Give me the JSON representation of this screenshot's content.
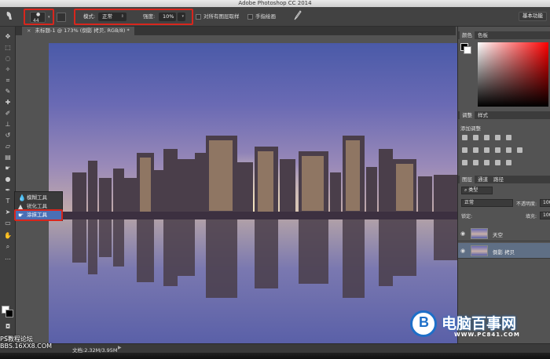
{
  "window": {
    "title": "Adobe Photoshop CC 2014"
  },
  "options": {
    "brush_size": "44",
    "mode_label": "模式:",
    "mode_value": "正常",
    "strength_label": "强度:",
    "strength_value": "10%",
    "sample_all_label": "对所有图层取样",
    "finger_paint_label": "手指绘画",
    "workspace_label": "基本功能"
  },
  "document": {
    "tab_label": "未标题-1 @ 173% (倒影 拷贝, RGB/8) *"
  },
  "tool_flyout": {
    "items": [
      {
        "label": "模糊工具"
      },
      {
        "label": "锐化工具"
      },
      {
        "label": "涂抹工具"
      }
    ]
  },
  "panels": {
    "color_tab": "颜色",
    "swatches_tab": "色板",
    "adjust_tab": "调整",
    "styles_tab": "样式",
    "add_adjust": "添加调整",
    "layers_tab": "图层",
    "channels_tab": "通道",
    "paths_tab": "路径",
    "kind_label": "类型",
    "blend_mode": "正常",
    "opacity_label": "不透明度:",
    "opacity_value": "100",
    "lock_label": "锁定:",
    "fill_label": "填充:",
    "fill_value": "100",
    "layers": [
      {
        "name": "天空"
      },
      {
        "name": "倒影 拷贝"
      }
    ]
  },
  "status": {
    "doc_info": "文档:2.32M/3.95M"
  },
  "watermarks": {
    "left": "PS教程论坛\nBBS.16XX8.COM",
    "brand": "电脑百事网",
    "brand_url": "WWW.PC841.COM"
  }
}
